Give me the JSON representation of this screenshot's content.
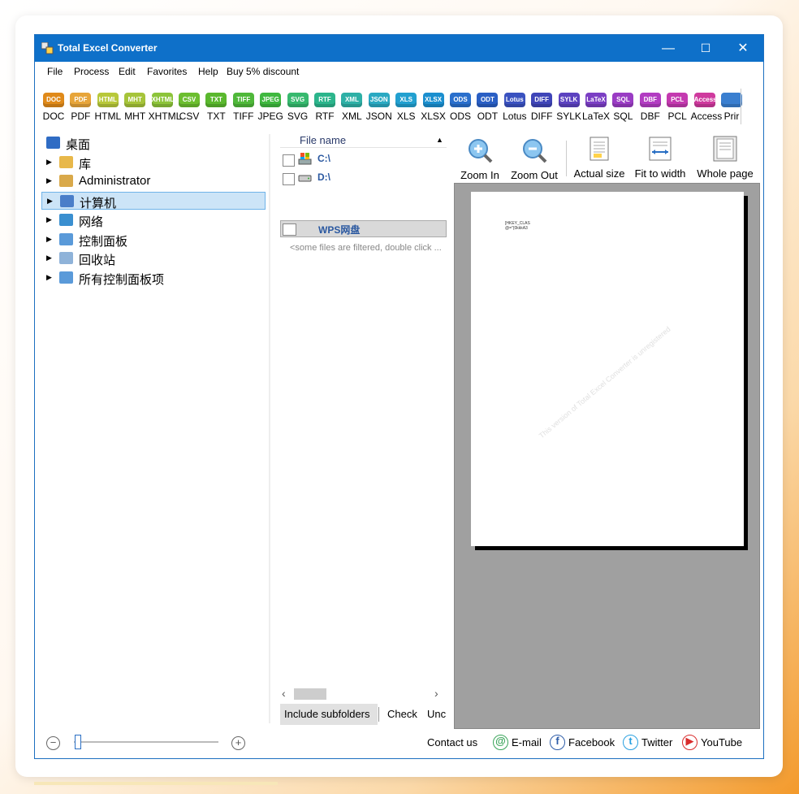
{
  "window": {
    "title": "Total Excel Converter"
  },
  "window_controls": {
    "minimize": "—",
    "maximize": "☐",
    "close": "✕"
  },
  "menu": [
    "File",
    "Process",
    "Edit",
    "Favorites",
    "Help",
    "Buy 5% discount"
  ],
  "toolbar": [
    {
      "label": "DOC",
      "icon_text": "DOC",
      "color": "#e08a1a"
    },
    {
      "label": "PDF",
      "icon_text": "PDF",
      "color": "#e7a53a"
    },
    {
      "label": "HTML",
      "icon_text": "HTML",
      "color": "#b8c83a"
    },
    {
      "label": "MHT",
      "icon_text": "MHT",
      "color": "#a6c43a"
    },
    {
      "label": "XHTML",
      "icon_text": "XHTML",
      "color": "#8cc43a"
    },
    {
      "label": "CSV",
      "icon_text": "CSV",
      "color": "#6cbe2f"
    },
    {
      "label": "TXT",
      "icon_text": "TXT",
      "color": "#5ab82e"
    },
    {
      "label": "TIFF",
      "icon_text": "TIFF",
      "color": "#4fb83a"
    },
    {
      "label": "JPEG",
      "icon_text": "JPEG",
      "color": "#3fb83f"
    },
    {
      "label": "SVG",
      "icon_text": "SVG",
      "color": "#37b96e"
    },
    {
      "label": "RTF",
      "icon_text": "RTF",
      "color": "#2cb58c"
    },
    {
      "label": "XML",
      "icon_text": "XML",
      "color": "#2eb0a6"
    },
    {
      "label": "JSON",
      "icon_text": "JSON",
      "color": "#2aa9c2"
    },
    {
      "label": "XLS",
      "icon_text": "XLS",
      "color": "#22a0d0"
    },
    {
      "label": "XLSX",
      "icon_text": "XLSX",
      "color": "#1b8fcf"
    },
    {
      "label": "ODS",
      "icon_text": "ODS",
      "color": "#2a6fcc"
    },
    {
      "label": "ODT",
      "icon_text": "ODT",
      "color": "#2a5fc4"
    },
    {
      "label": "Lotus",
      "icon_text": "Lotus",
      "color": "#3a52c0"
    },
    {
      "label": "DIFF",
      "icon_text": "DIFF",
      "color": "#3f45b8"
    },
    {
      "label": "SYLK",
      "icon_text": "SYLK",
      "color": "#5c42c0"
    },
    {
      "label": "LaTeX",
      "icon_text": "LaTeX",
      "color": "#7b3fc4"
    },
    {
      "label": "SQL",
      "icon_text": "SQL",
      "color": "#9a3cc4"
    },
    {
      "label": "DBF",
      "icon_text": "DBF",
      "color": "#b23cc2"
    },
    {
      "label": "PCL",
      "icon_text": "PCL",
      "color": "#c43ab0"
    },
    {
      "label": "Access",
      "icon_text": "Access",
      "color": "#cf3a9e"
    },
    {
      "label": "Prir",
      "icon_text": "",
      "color": "#3a7fd0"
    }
  ],
  "tree": [
    {
      "label": "桌面",
      "icon": "desktop-icon",
      "color": "#2f6cc4",
      "arrow": ""
    },
    {
      "label": "库",
      "icon": "library-icon",
      "color": "#e8b84a",
      "arrow": "▶"
    },
    {
      "label": "Administrator",
      "icon": "user-folder-icon",
      "color": "#d9a94a",
      "arrow": "▶"
    },
    {
      "label": "计算机",
      "icon": "computer-icon",
      "color": "#4a7ec9",
      "arrow": "▶"
    },
    {
      "label": "网络",
      "icon": "network-icon",
      "color": "#3a8fd0",
      "arrow": "▶"
    },
    {
      "label": "控制面板",
      "icon": "control-panel-icon",
      "color": "#5a9ad9",
      "arrow": "▶"
    },
    {
      "label": "回收站",
      "icon": "recycle-bin-icon",
      "color": "#8fb3d9",
      "arrow": "▶"
    },
    {
      "label": "所有控制面板项",
      "icon": "control-panel-items-icon",
      "color": "#5a9ad9",
      "arrow": "▶"
    }
  ],
  "filelist": {
    "header": "File name",
    "sort_arrow": "▲",
    "rows": [
      {
        "label": "C:\\",
        "icon": "drive-c-icon"
      },
      {
        "label": "D:\\",
        "icon": "drive-d-icon"
      },
      {
        "label": "WPS网盘",
        "icon": ""
      }
    ],
    "filtered_note": "<some files are filtered, double click ...",
    "scroll_left": "‹",
    "scroll_right": "›",
    "buttons": [
      "Include subfolders",
      "Check",
      "Unc"
    ]
  },
  "preview": {
    "buttons": [
      "Zoom In",
      "Zoom Out",
      "Actual size",
      "Fit to width",
      "Whole page"
    ],
    "page_text_1": "[HKEY_CLAS",
    "page_text_2": "@=\"{0kkkA3",
    "watermark": "This version of Total Excel Converter is unregistered"
  },
  "bottom": {
    "zoom_minus": "−",
    "zoom_plus": "+",
    "zoom_level": 0.02,
    "contact": "Contact us",
    "links": [
      {
        "label": "E-mail",
        "icon": "email-icon",
        "glyph": "@",
        "color": "#3aa55a"
      },
      {
        "label": "Facebook",
        "icon": "facebook-icon",
        "glyph": "f",
        "color": "#2d5ca8"
      },
      {
        "label": "Twitter",
        "icon": "twitter-icon",
        "glyph": "t",
        "color": "#28a0e0"
      },
      {
        "label": "YouTube",
        "icon": "youtube-icon",
        "glyph": "▶",
        "color": "#d92b2b"
      }
    ]
  }
}
